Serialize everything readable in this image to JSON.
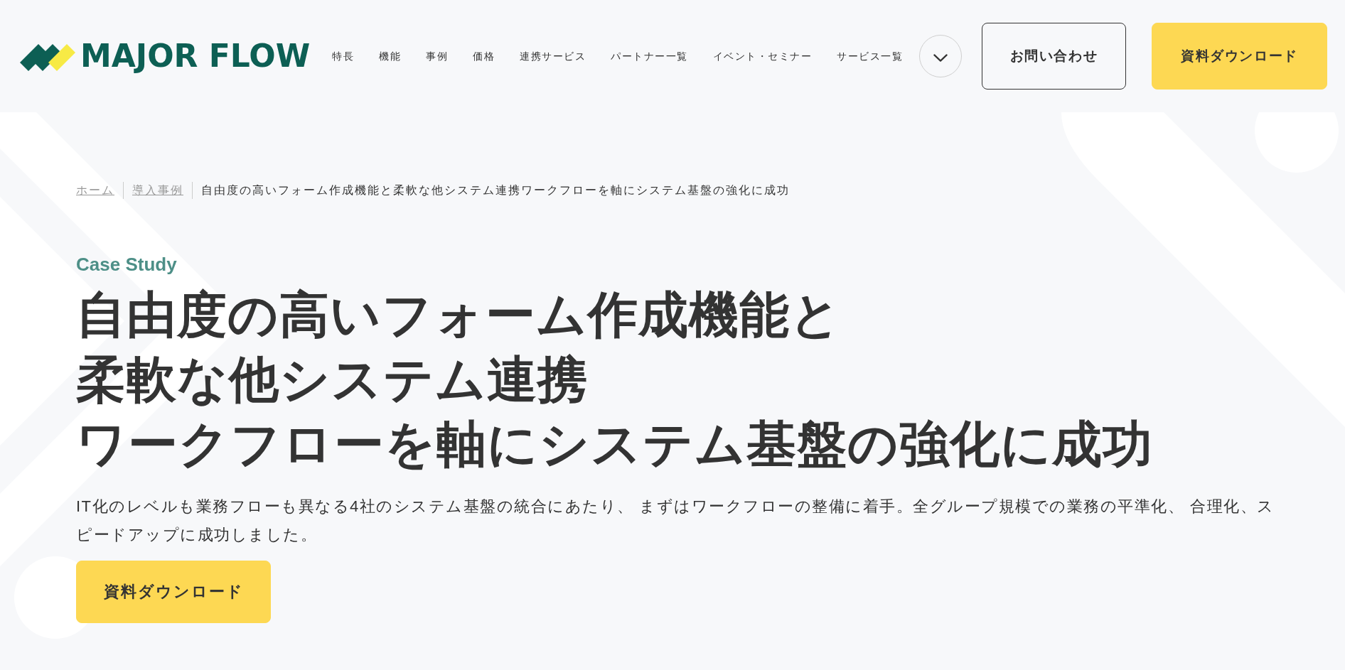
{
  "header": {
    "logo": {
      "text": "MAJOR FLOW"
    },
    "nav": [
      {
        "label": "特長"
      },
      {
        "label": "機能"
      },
      {
        "label": "事例"
      },
      {
        "label": "価格"
      },
      {
        "label": "連携サービス"
      },
      {
        "label": "パートナー一覧"
      },
      {
        "label": "イベント・セミナー"
      },
      {
        "label": "サービス一覧"
      }
    ],
    "buttons": [
      {
        "label": "お問い合わせ",
        "kind": "outline"
      },
      {
        "label": "資料ダウンロード",
        "kind": "filled"
      }
    ]
  },
  "breadcrumb": [
    {
      "label": "ホーム",
      "kind": "link"
    },
    {
      "label": "導入事例",
      "kind": "link"
    },
    {
      "label": "自由度の高いフォーム作成機能と柔軟な他システム連携ワークフローを軸にシステム基盤の強化に成功",
      "kind": "current"
    }
  ],
  "hero": {
    "eyebrow": "Case Study",
    "title_lines": [
      "自由度の高いフォーム作成機能と",
      "柔軟な他システム連携",
      "ワークフローを軸にシステム基盤の強化に成功"
    ],
    "description": "IT化のレベルも業務フローも異なる4社のシステム基盤の統合にあたり、 まずはワークフローの整備に着手。全グループ規模での業務の平準化、 合理化、スピードアップに成功しました。",
    "button": {
      "label": "資料ダウンロード",
      "kind": "filled"
    }
  }
}
